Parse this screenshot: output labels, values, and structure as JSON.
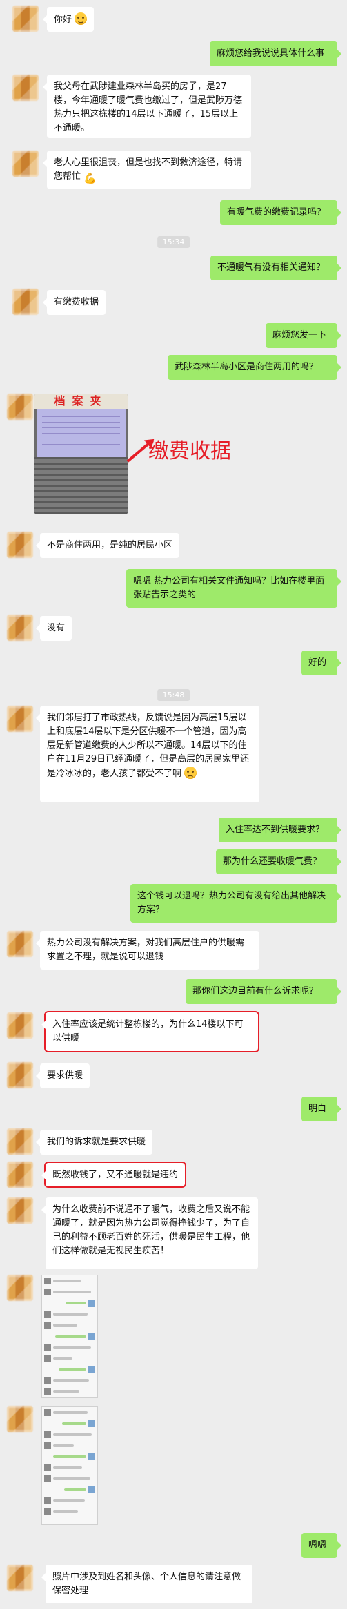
{
  "messages": {
    "m1": "你好",
    "m2": "麻烦您给我说说具体什么事",
    "m3": "我父母在武陟建业森林半岛买的房子，是27楼，今年通暖了暖气费也缴过了，但是武陟万德热力只把这栋楼的14层以下通暖了，15层以上不通暖。",
    "m4": "老人心里很沮丧，但是也找不到救济途径，特请您帮忙",
    "m5": "有暖气费的缴费记录吗？",
    "t1": "15:34",
    "m6": "不通暖气有没有相关通知？",
    "m7": "有缴费收据",
    "m8": "麻烦您发一下",
    "m9": "武陟森林半岛小区是商住两用的吗？",
    "photo_title": "档案夹",
    "annotation": "缴费收据",
    "m10": "不是商住两用，是纯的居民小区",
    "m11": "嗯嗯 热力公司有相关文件通知吗？比如在楼里面张贴告示之类的",
    "m12": "没有",
    "m13": "好的",
    "t2": "15:48",
    "m14": "我们邻居打了市政热线，反馈说是因为高层15层以上和底层14层以下是分区供暖不一个管道，因为高层是新管道缴费的人少所以不通暖。14层以下的住户在11月29日已经通暖了，但是高层的居民家里还是冷冰冰的，老人孩子都受不了啊",
    "m15": "入住率达不到供暖要求？",
    "m16": "那为什么还要收暖气费？",
    "m17": "这个钱可以退吗？热力公司有没有给出其他解决方案？",
    "m18": "热力公司没有解决方案，对我们高层住户的供暖需求置之不理，就是说可以退钱",
    "m19": "那你们这边目前有什么诉求呢？",
    "m20": "入住率应该是统计整栋楼的，为什么14楼以下可以供暖",
    "m21": "要求供暖",
    "m22": "明白",
    "m23": "我们的诉求就是要求供暖",
    "m24": "既然收钱了，又不通暖就是违约",
    "m25": "为什么收费前不说通不了暖气，收费之后又说不能通暖了，就是因为热力公司觉得挣钱少了，为了自己的利益不顾老百姓的死活，供暖是民生工程，他们这样做就是无视民生疾苦！",
    "m26": "嗯嗯",
    "m27": "照片中涉及到姓名和头像、个人信息的请注意做保密处理"
  },
  "colors": {
    "incoming": "#ffffff",
    "outgoing": "#9eea6a",
    "annotation": "#e61e28",
    "background": "#ededed"
  },
  "icons": {
    "smile": "smile-emoji-icon",
    "strong": "strong-emoji-icon",
    "frown": "frown-emoji-icon"
  }
}
